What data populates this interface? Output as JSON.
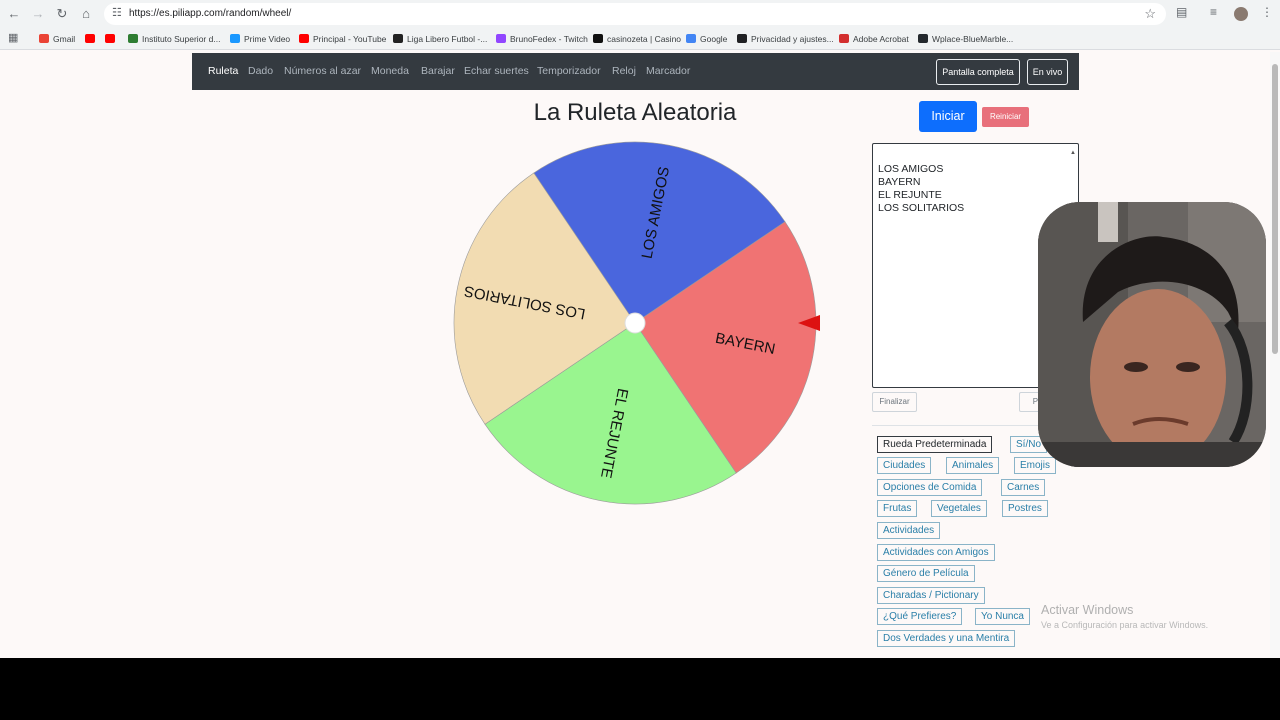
{
  "browser": {
    "url": "https://es.piliapp.com/random/wheel/",
    "bookmarks": [
      {
        "label": "Gmail",
        "icon": "gmail-icon",
        "color": "#ea4335"
      },
      {
        "label": "",
        "icon": "youtube-icon",
        "color": "#ff0000"
      },
      {
        "label": "",
        "icon": "youtube-icon",
        "color": "#ff0000"
      },
      {
        "label": "Instituto Superior d...",
        "icon": "institute-icon",
        "color": "#2e7d32"
      },
      {
        "label": "Prime Video",
        "icon": "prime-video-icon",
        "color": "#1a98ff"
      },
      {
        "label": "Principal - YouTube",
        "icon": "youtube-icon",
        "color": "#ff0000"
      },
      {
        "label": "Liga Libero Futbol -...",
        "icon": "liga-icon",
        "color": "#222222"
      },
      {
        "label": "BrunoFedex - Twitch",
        "icon": "twitch-icon",
        "color": "#9146ff"
      },
      {
        "label": "casinozeta | Casino",
        "icon": "casino-icon",
        "color": "#111111"
      },
      {
        "label": "Google",
        "icon": "google-icon",
        "color": "#4285f4"
      },
      {
        "label": "Privacidad y ajustes...",
        "icon": "privacy-icon",
        "color": "#202124"
      },
      {
        "label": "Adobe Acrobat",
        "icon": "acrobat-icon",
        "color": "#d32f2f"
      },
      {
        "label": "Wplace-BlueMarble...",
        "icon": "github-icon",
        "color": "#24292e"
      }
    ]
  },
  "nav": {
    "items": [
      "Ruleta",
      "Dado",
      "Números al azar",
      "Moneda",
      "Barajar",
      "Echar suertes",
      "Temporizador",
      "Reloj",
      "Marcador"
    ],
    "fullscreen_label": "Pantalla completa",
    "live_label": "En vivo"
  },
  "page": {
    "title": "La Ruleta Aleatoria",
    "start_label": "Iniciar",
    "reset_label": "Reiniciar",
    "entries": [
      "LOS AMIGOS",
      "BAYERN",
      "EL REJUNTE",
      "LOS SOLITARIOS"
    ],
    "finish_label": "Finalizar",
    "other_label": "Por",
    "presets": [
      "Rueda Predeterminada",
      "Sí/No",
      "Ciudades",
      "Animales",
      "Emojis",
      "Opciones de Comida",
      "Carnes",
      "Frutas",
      "Vegetales",
      "Postres",
      "Actividades",
      "Actividades con Amigos",
      "Género de Película",
      "Charadas / Pictionary",
      "¿Qué Prefieres?",
      "Yo Nunca",
      "Dos Verdades y una Mentira"
    ]
  },
  "wheel": {
    "segments": [
      {
        "label": "LOS AMIGOS",
        "color": "#4a66dd"
      },
      {
        "label": "BAYERN",
        "color": "#f07373"
      },
      {
        "label": "EL REJUNTE",
        "color": "#99f58f"
      },
      {
        "label": "LOS SOLITARIOS",
        "color": "#f2dcb2"
      }
    ],
    "pointer_color": "#dd1111"
  },
  "watermark": {
    "line1": "Activar Windows",
    "line2": "Ve a Configuración para activar Windows."
  }
}
